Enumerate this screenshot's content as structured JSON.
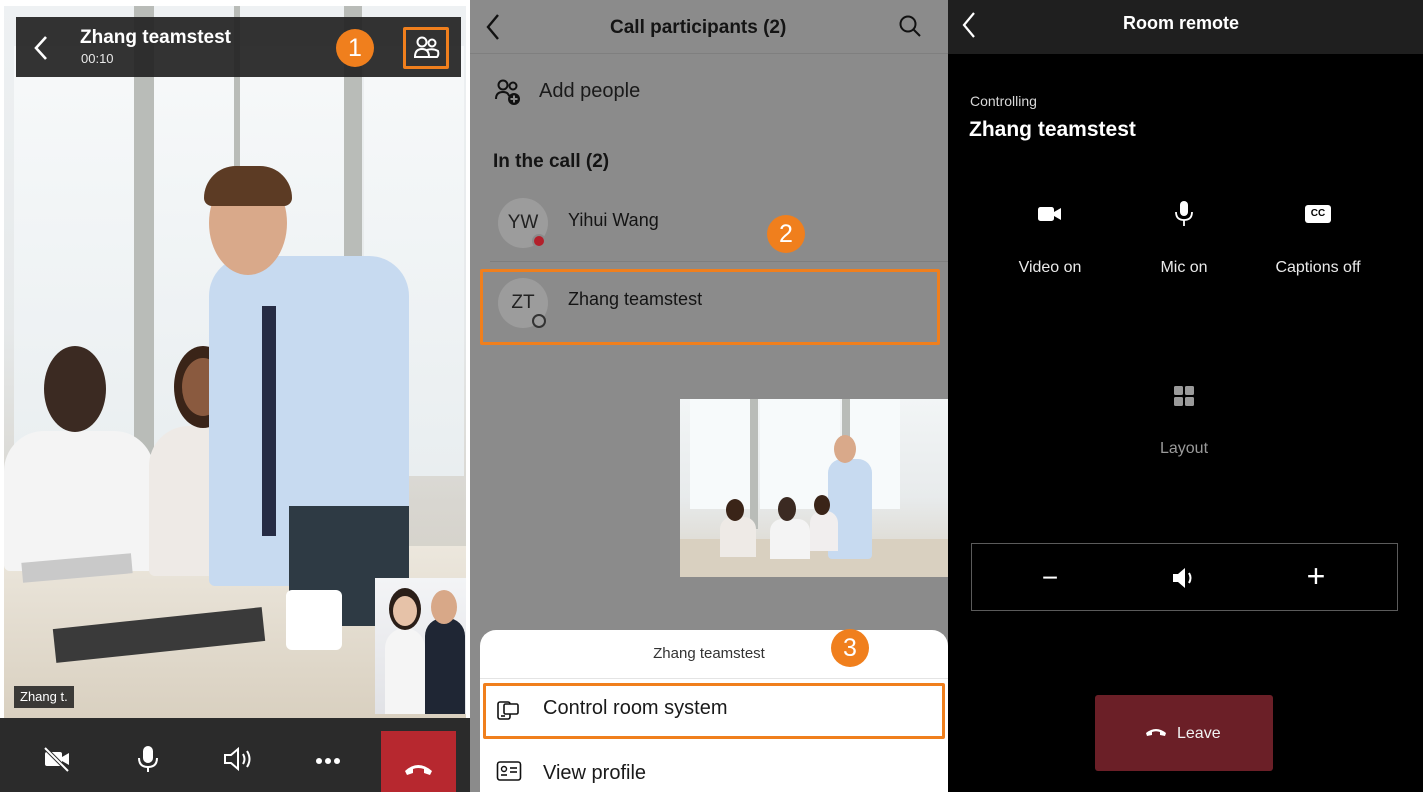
{
  "call_view": {
    "title": "Zhang teamstest",
    "timer": "00:10",
    "self_name_tag": "Zhang t.",
    "step_badge": "1",
    "controls": [
      "video-off-icon",
      "mic-icon",
      "speaker-icon",
      "more-icon",
      "hang-up-icon"
    ]
  },
  "participants_view": {
    "title": "Call participants (2)",
    "add_people": "Add people",
    "section_heading": "In the call (2)",
    "participants": [
      {
        "initials": "YW",
        "name": "Yihui Wang",
        "status": "busy"
      },
      {
        "initials": "ZT",
        "name": "Zhang teamstest",
        "status": "offline"
      }
    ],
    "step_badge_2": "2",
    "step_badge_3": "3",
    "sheet": {
      "header": "Zhang teamstest",
      "items": [
        "Control room system",
        "View profile"
      ]
    }
  },
  "remote_view": {
    "title": "Room remote",
    "controlling_label": "Controlling",
    "room_name": "Zhang teamstest",
    "options": [
      {
        "icon": "video-camera-icon",
        "label": "Video on"
      },
      {
        "icon": "microphone-icon",
        "label": "Mic on"
      },
      {
        "icon": "captions-icon",
        "label": "Captions off"
      }
    ],
    "layout_label": "Layout",
    "volume": {
      "minus": "−",
      "plus": "+"
    },
    "leave_label": "Leave"
  },
  "colors": {
    "accent_orange": "#f07f1d",
    "end_call_red": "#b7282f",
    "leave_red": "#6b1f27",
    "dimmed_overlay": "#8b8b8b"
  }
}
